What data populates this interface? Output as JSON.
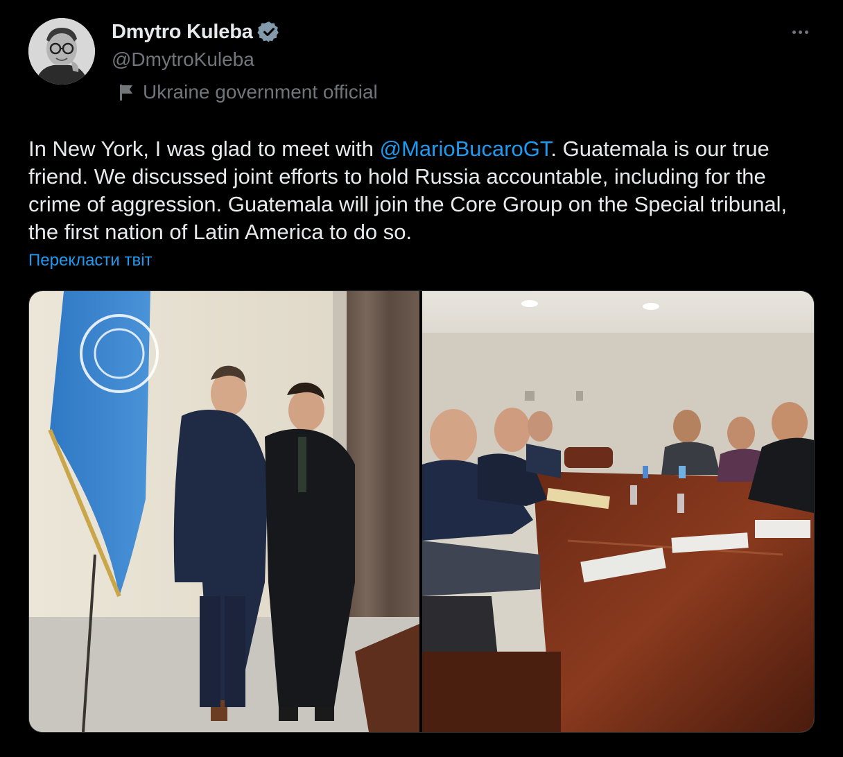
{
  "author": {
    "display_name": "Dmytro Kuleba",
    "handle": "@DmytroKuleba",
    "verified_icon": "verified-badge-icon",
    "affiliation_icon": "government-flag-icon",
    "affiliation": "Ukraine government official"
  },
  "tweet": {
    "text_before": "In New York, I was glad to meet with ",
    "mention": "@MarioBucaroGT",
    "text_after": ". Guatemala is our true friend. We discussed joint efforts to hold Russia accountable, including for the crime of aggression. Guatemala will join the Core Group on the Special tribunal, the first nation of Latin America to do so.",
    "translate_label": "Перекласти твіт"
  },
  "media": {
    "photos": [
      {
        "name": "photo-handshake-un-flag"
      },
      {
        "name": "photo-meeting-table"
      }
    ]
  },
  "colors": {
    "background": "#000000",
    "text": "#e7e9ea",
    "secondary": "#71767b",
    "link": "#1d9bf0",
    "verified": "#829aab"
  },
  "icons": {
    "more": "more-horizontal-icon"
  }
}
